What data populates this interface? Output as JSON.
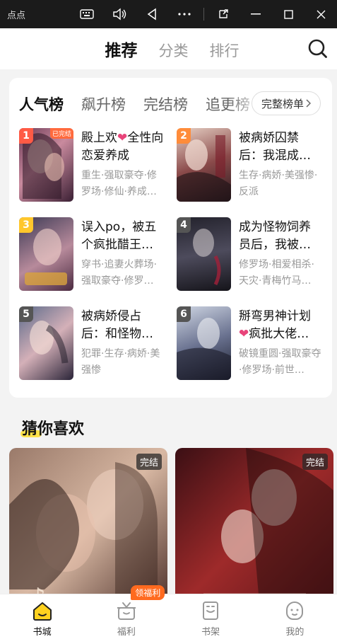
{
  "titlebar": {
    "app_title": "点点"
  },
  "nav": {
    "tabs": [
      "推荐",
      "分类",
      "排行"
    ]
  },
  "ranking": {
    "tabs": [
      "人气榜",
      "飙升榜",
      "完结榜",
      "追更榜"
    ],
    "full_list_label": "完整榜单",
    "books": [
      {
        "rank": "1",
        "title_pre": "殿上欢",
        "has_heart": true,
        "title_post": "全性向恋爱养成",
        "tags": "重生·强取豪夺·修罗场·修仙·养成…",
        "cover_badge": "已完结",
        "rank_color": "#ff5a45"
      },
      {
        "rank": "2",
        "title_pre": "被病娇囚禁后：我混成…",
        "has_heart": false,
        "title_post": "",
        "tags": "生存·病娇·美强惨·反派",
        "cover_badge": "",
        "rank_color": "#ff8c3a"
      },
      {
        "rank": "3",
        "title_pre": "误入po，被五个疯批醋王…",
        "has_heart": false,
        "title_post": "",
        "tags": "穿书·追妻火葬场·强取豪夺·修罗…",
        "cover_badge": "",
        "rank_color": "#ffc72c"
      },
      {
        "rank": "4",
        "title_pre": "成为怪物饲养员后，我被…",
        "has_heart": false,
        "title_post": "",
        "tags": "修罗场·相爱相杀·天灾·青梅竹马…",
        "cover_badge": "",
        "rank_color": "#555555"
      },
      {
        "rank": "5",
        "title_pre": "被病娇侵占后：和怪物…",
        "has_heart": false,
        "title_post": "",
        "tags": "犯罪·生存·病娇·美强惨",
        "cover_badge": "",
        "rank_color": "#555555"
      },
      {
        "rank": "6",
        "title_pre": "掰弯男神计划",
        "has_heart": true,
        "title_post": "疯批大佬…",
        "tags": "破镜重圆·强取豪夺·修罗场·前世…",
        "cover_badge": "",
        "rank_color": "#555555"
      }
    ]
  },
  "guess": {
    "title": "猜你喜欢",
    "cards": [
      {
        "badge": "完结"
      },
      {
        "badge": "完结"
      }
    ]
  },
  "bottom_nav": {
    "items": [
      "书城",
      "福利",
      "书架",
      "我的"
    ],
    "welfare_badge": "领福利"
  },
  "colors": {
    "accent": "#ffe24a",
    "heart": "#e8447a",
    "badge_orange": "#ff6a1f"
  }
}
